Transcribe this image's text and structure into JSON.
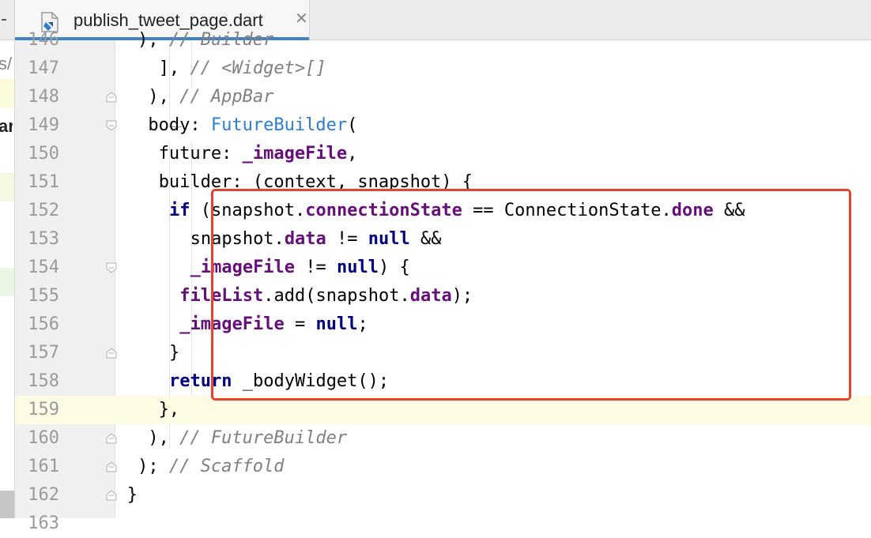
{
  "tab": {
    "filename": "publish_tweet_page.dart",
    "close_glyph": "✕"
  },
  "left_pane": {
    "frag_1": "s/",
    "frag_2": "ar"
  },
  "lines": [
    {
      "num": "146",
      "parts": [
        {
          "t": "), "
        },
        {
          "t": "// Builder",
          "c": "cm"
        }
      ]
    },
    {
      "num": "147",
      "parts": [
        {
          "t": "], "
        },
        {
          "t": "// <Widget>[]",
          "c": "cm"
        }
      ]
    },
    {
      "num": "148",
      "parts": [
        {
          "t": "), "
        },
        {
          "t": "// AppBar",
          "c": "cm"
        }
      ]
    },
    {
      "num": "149",
      "parts": [
        {
          "t": "body: "
        },
        {
          "t": "FutureBuilder",
          "c": "cls"
        },
        {
          "t": "("
        }
      ]
    },
    {
      "num": "150",
      "parts": [
        {
          "t": "future: "
        },
        {
          "t": "_imageFile",
          "c": "fld"
        },
        {
          "t": ","
        }
      ]
    },
    {
      "num": "151",
      "parts": [
        {
          "t": "builder: (context, snapshot) {"
        }
      ]
    },
    {
      "num": "152",
      "parts": [
        {
          "t": "if",
          "c": "kw"
        },
        {
          "t": " (snapshot."
        },
        {
          "t": "connectionState",
          "c": "fld"
        },
        {
          "t": " == ConnectionState."
        },
        {
          "t": "done",
          "c": "fld"
        },
        {
          "t": " &&"
        }
      ]
    },
    {
      "num": "153",
      "parts": [
        {
          "t": "snapshot."
        },
        {
          "t": "data",
          "c": "fld"
        },
        {
          "t": " != "
        },
        {
          "t": "null",
          "c": "kw"
        },
        {
          "t": " &&"
        }
      ]
    },
    {
      "num": "154",
      "parts": [
        {
          "t": "_imageFile",
          "c": "fld"
        },
        {
          "t": " != "
        },
        {
          "t": "null",
          "c": "kw"
        },
        {
          "t": ") {"
        }
      ]
    },
    {
      "num": "155",
      "parts": [
        {
          "t": "fileList",
          "c": "fld"
        },
        {
          "t": ".add(snapshot."
        },
        {
          "t": "data",
          "c": "fld"
        },
        {
          "t": ");"
        }
      ]
    },
    {
      "num": "156",
      "parts": [
        {
          "t": "_imageFile",
          "c": "fld"
        },
        {
          "t": " = "
        },
        {
          "t": "null",
          "c": "kw"
        },
        {
          "t": ";"
        }
      ]
    },
    {
      "num": "157",
      "parts": [
        {
          "t": "}"
        }
      ]
    },
    {
      "num": "158",
      "parts": [
        {
          "t": "return",
          "c": "kw"
        },
        {
          "t": " _bodyWidget();"
        }
      ]
    },
    {
      "num": "159",
      "parts": [
        {
          "t": "},"
        }
      ]
    },
    {
      "num": "160",
      "parts": [
        {
          "t": "), "
        },
        {
          "t": "// FutureBuilder",
          "c": "cm"
        }
      ]
    },
    {
      "num": "161",
      "parts": [
        {
          "t": "); "
        },
        {
          "t": "// Scaffold",
          "c": "cm"
        }
      ]
    },
    {
      "num": "162",
      "parts": [
        {
          "t": "}"
        }
      ]
    },
    {
      "num": "163",
      "parts": []
    }
  ]
}
